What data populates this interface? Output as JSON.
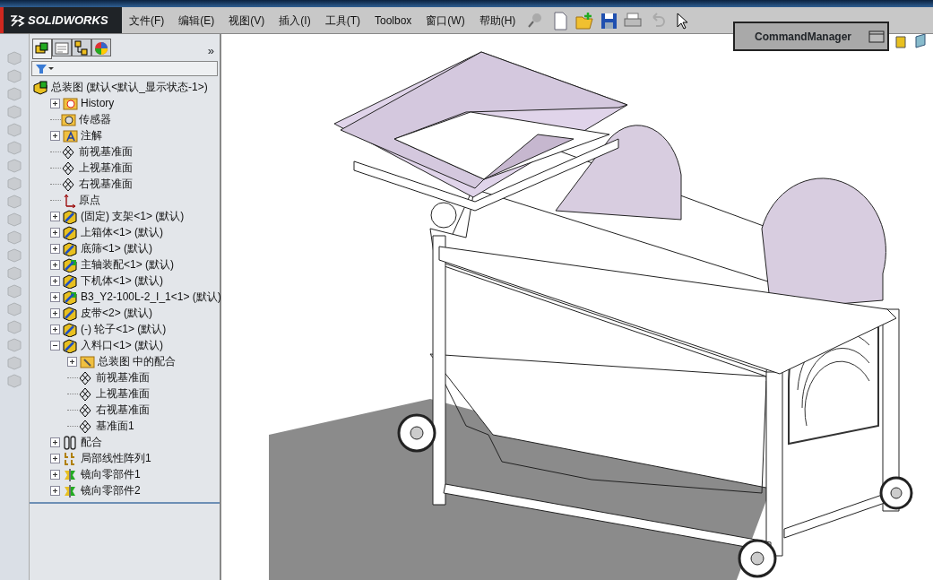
{
  "app": {
    "logo": "SOLIDWORKS"
  },
  "menu": [
    "文件(F)",
    "编辑(E)",
    "视图(V)",
    "插入(I)",
    "工具(T)",
    "Toolbox",
    "窗口(W)",
    "帮助(H)"
  ],
  "popup": {
    "label": "CommandManager"
  },
  "panel_more": "»",
  "panel_tabs": [
    {
      "kind": "tree",
      "selected": true
    },
    {
      "kind": "property",
      "selected": false
    },
    {
      "kind": "config",
      "selected": false
    },
    {
      "kind": "display",
      "selected": false
    }
  ],
  "tree": {
    "label": "总装图  (默认<默认_显示状态-1>)",
    "kind": "assembly",
    "children": [
      {
        "label": "History",
        "kind": "history",
        "expanded": false
      },
      {
        "label": "传感器",
        "kind": "sensor"
      },
      {
        "label": "注解",
        "kind": "annotation",
        "expanded": false
      },
      {
        "label": "前视基准面",
        "kind": "plane"
      },
      {
        "label": "上视基准面",
        "kind": "plane"
      },
      {
        "label": "右视基准面",
        "kind": "plane"
      },
      {
        "label": "原点",
        "kind": "origin"
      },
      {
        "label": "(固定) 支架<1> (默认)",
        "kind": "part",
        "expanded": false
      },
      {
        "label": "上箱体<1> (默认)",
        "kind": "part",
        "expanded": false
      },
      {
        "label": "底筛<1> (默认)",
        "kind": "part",
        "expanded": false
      },
      {
        "label": "主轴装配<1> (默认)",
        "kind": "subassembly",
        "expanded": false
      },
      {
        "label": "下机体<1> (默认)",
        "kind": "part",
        "expanded": false
      },
      {
        "label": "B3_Y2-100L-2_I_1<1> (默认)",
        "kind": "subassembly",
        "expanded": false
      },
      {
        "label": "皮带<2> (默认)",
        "kind": "part",
        "expanded": false
      },
      {
        "label": "(-) 轮子<1> (默认)",
        "kind": "part",
        "expanded": false
      },
      {
        "label": "入料口<1> (默认)",
        "kind": "part",
        "expanded": true,
        "children": [
          {
            "label": "总装图 中的配合",
            "kind": "matefolder",
            "expanded": false
          },
          {
            "label": "前视基准面",
            "kind": "plane"
          },
          {
            "label": "上视基准面",
            "kind": "plane"
          },
          {
            "label": "右视基准面",
            "kind": "plane"
          },
          {
            "label": "基准面1",
            "kind": "plane"
          }
        ]
      },
      {
        "label": "配合",
        "kind": "mates",
        "expanded": false
      },
      {
        "label": "局部线性阵列1",
        "kind": "pattern",
        "expanded": false
      },
      {
        "label": "镜向零部件1",
        "kind": "mirror",
        "expanded": false
      },
      {
        "label": "镜向零部件2",
        "kind": "mirror",
        "expanded": false
      }
    ]
  }
}
